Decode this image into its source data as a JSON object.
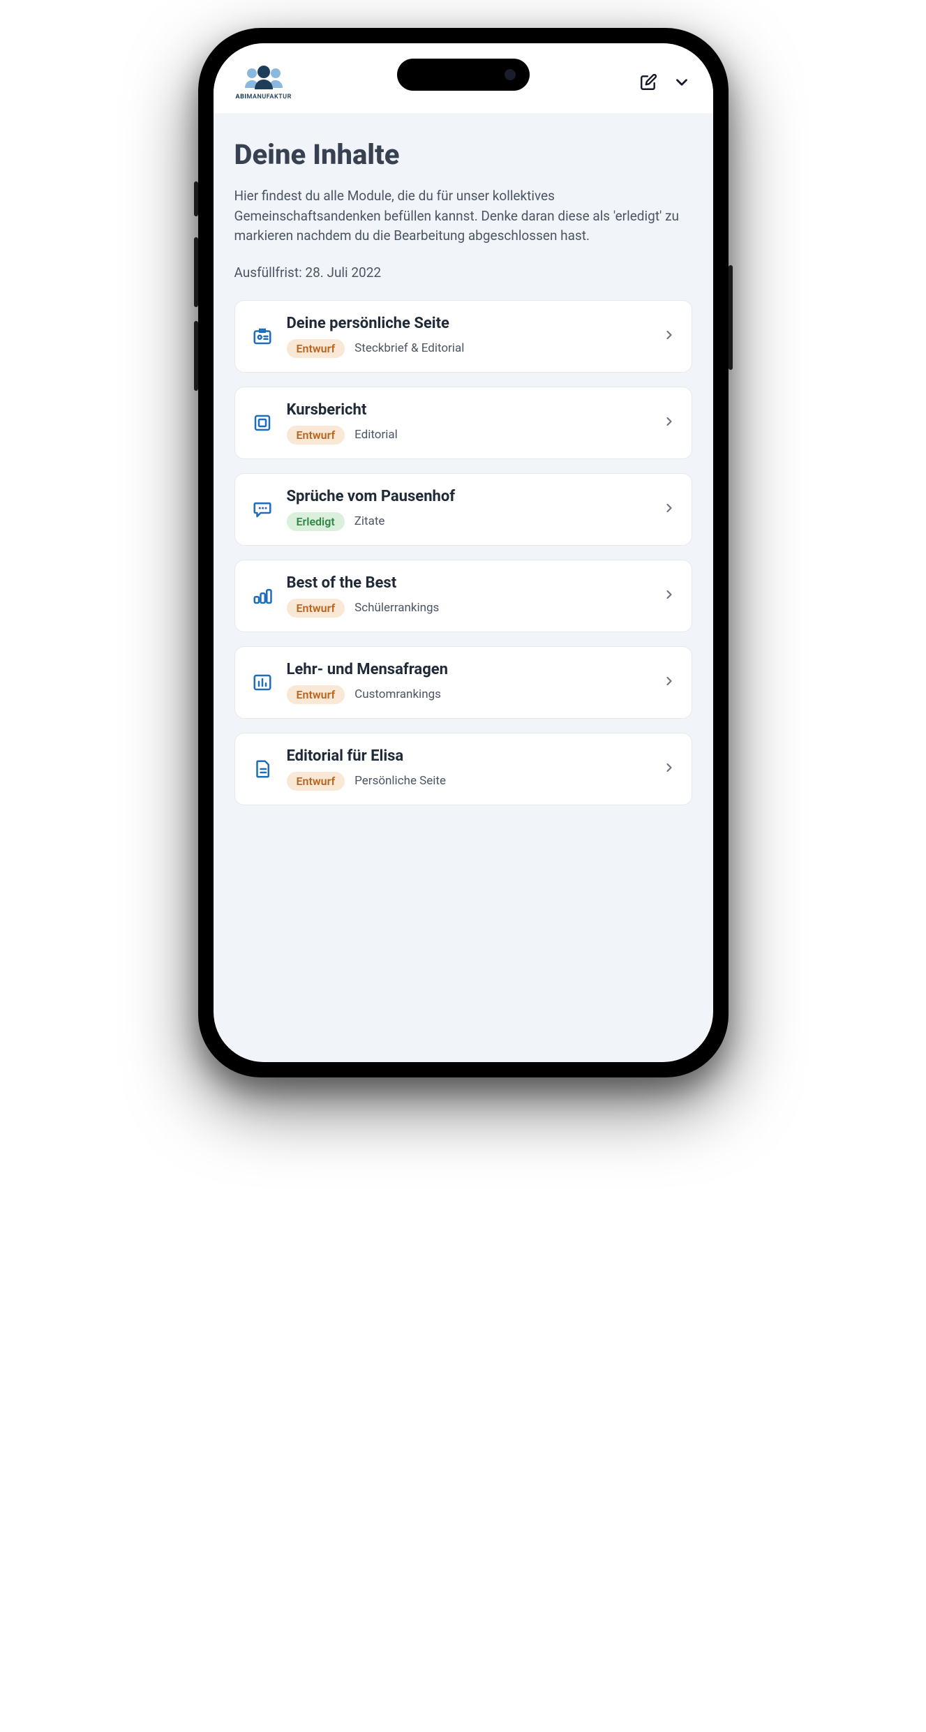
{
  "brand": {
    "bold": "ABI",
    "rest": "MANUFAKTUR"
  },
  "header": {
    "title": "Deine Inhalte",
    "description": "Hier findest du alle Module, die du für unser kollektives Gemeinschaftsandenken befüllen kannst. Denke daran diese als 'erledigt' zu markieren nachdem du die Bearbeitung abgeschlossen hast.",
    "deadline": "Ausfüllfrist: 28. Juli 2022"
  },
  "status_labels": {
    "draft": "Entwurf",
    "done": "Erledigt"
  },
  "items": [
    {
      "icon": "id-card",
      "title": "Deine persönliche Seite",
      "status": "draft",
      "category": "Steckbrief & Editorial"
    },
    {
      "icon": "news",
      "title": "Kursbericht",
      "status": "draft",
      "category": "Editorial"
    },
    {
      "icon": "chat",
      "title": "Sprüche vom Pausenhof",
      "status": "done",
      "category": "Zitate"
    },
    {
      "icon": "bars",
      "title": "Best of the Best",
      "status": "draft",
      "category": "Schülerrankings"
    },
    {
      "icon": "poll",
      "title": "Lehr- und Mensafragen",
      "status": "draft",
      "category": "Customrankings"
    },
    {
      "icon": "doc",
      "title": "Editorial für Elisa",
      "status": "draft",
      "category": "Persönliche Seite"
    }
  ]
}
